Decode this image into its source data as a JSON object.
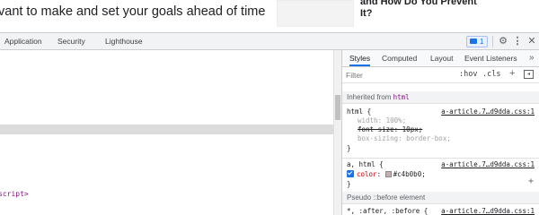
{
  "page": {
    "text": "vant to make and set your goals ahead of time",
    "headline_line1": "and How Do You Prevent",
    "headline_line2": "It?"
  },
  "devtools": {
    "tabs": [
      "Application",
      "Security",
      "Lighthouse"
    ],
    "issues_count": "1",
    "icons": [
      "gear-icon",
      "more-vert-icon",
      "close-icon"
    ],
    "gear_glyph": "⚙",
    "more_glyph": "⋮",
    "close_glyph": "✕"
  },
  "elements": {
    "script_tail": "script>"
  },
  "styles": {
    "tabs": [
      "Styles",
      "Computed",
      "Layout",
      "Event Listeners"
    ],
    "active_tab": "Styles",
    "more_glyph": "»",
    "filter_placeholder": "Filter",
    "hov": ":hov",
    "cls": ".cls",
    "new_rule": "+",
    "toggle_glyph": "◂",
    "inherited_label": "Inherited from",
    "inherited_tag": "html",
    "rule1": {
      "selector": "html {",
      "source": "a-article.7…d9dda.css:1",
      "props": [
        {
          "text": "width: 100%;"
        },
        {
          "text": "font-size: 10px;"
        },
        {
          "text": "box-sizing: border-box;"
        }
      ],
      "close": "}"
    },
    "rule2": {
      "selector": "a, html {",
      "source": "a-article.7…d9dda.css:1",
      "prop_name": "color",
      "prop_value": "#c4b0b0;",
      "close": "}",
      "add": "+",
      "swatch_color": "#c4b0b0"
    },
    "pseudo_label": "Pseudo ::before element",
    "rule3": {
      "selector": "*, :after, :before {",
      "source": "a-article.7…d9dda.css:1"
    }
  },
  "colors": {
    "accent": "#1a73e8",
    "tag": "#881280",
    "property": "#c80000"
  }
}
